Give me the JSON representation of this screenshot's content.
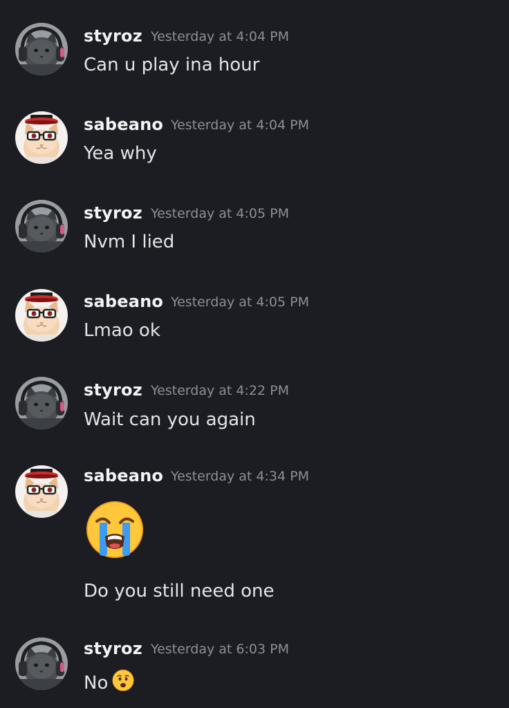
{
  "messages": [
    {
      "author": "styroz",
      "timestamp": "Yesterday at 4:04 PM",
      "text": "Can u play ina hour"
    },
    {
      "author": "sabeano",
      "timestamp": "Yesterday at 4:04 PM",
      "text": "Yea why"
    },
    {
      "author": "styroz",
      "timestamp": "Yesterday at 4:05 PM",
      "text": "Nvm I lied"
    },
    {
      "author": "sabeano",
      "timestamp": "Yesterday at 4:05 PM",
      "text": "Lmao ok"
    },
    {
      "author": "styroz",
      "timestamp": "Yesterday at 4:22 PM",
      "text": "Wait can you again"
    },
    {
      "author": "sabeano",
      "timestamp": "Yesterday at 4:34 PM",
      "emoji": "loudly-crying-face-emoji",
      "text": "Do you still need one"
    },
    {
      "author": "styroz",
      "timestamp": "Yesterday at 6:03 PM",
      "text": "No",
      "emoji": "frowning-open-mouth-emoji"
    }
  ],
  "colors": {
    "background": "#1c1d22",
    "username": "#f2f3f5",
    "timestamp": "#8d8f97",
    "message_text": "#e4e5e9"
  }
}
